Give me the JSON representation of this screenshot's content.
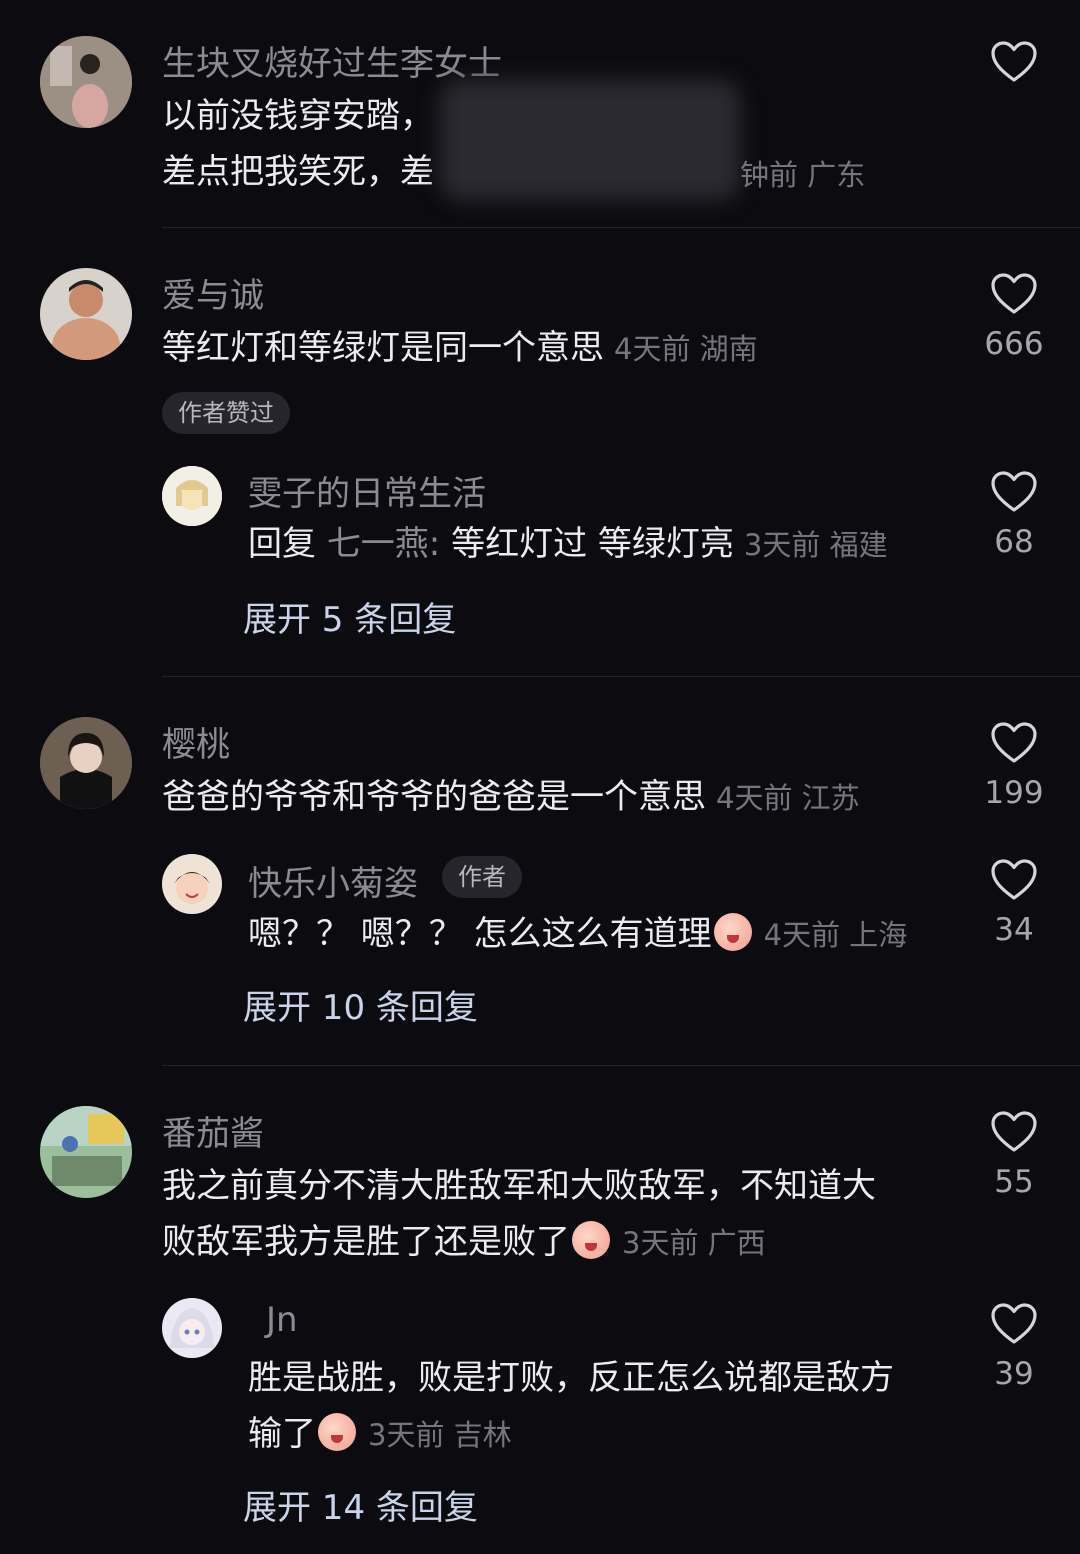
{
  "colors": {
    "background": "#0c0c10",
    "username": "#8b8b93",
    "expand": "#c9d3ea"
  },
  "comments": [
    {
      "username": "生块叉烧好过生李女士",
      "text_line1": "以前没钱穿安踏，",
      "text_line2": "差点把我笑死，差",
      "meta": "钟前 广东",
      "likes": ""
    },
    {
      "username": "爱与诚",
      "text": "等红灯和等绿灯是同一个意思",
      "meta": "4天前 湖南",
      "likes": "666",
      "tag": "作者赞过",
      "reply": {
        "username": "雯子的日常生活",
        "prefix": "回复",
        "reply_to": "七一燕:",
        "text": "等红灯过  等绿灯亮",
        "meta": "3天前 福建",
        "likes": "68"
      },
      "expand": "展开 5 条回复"
    },
    {
      "username": "樱桃",
      "text": "爸爸的爷爷和爷爷的爸爸是一个意思",
      "meta": "4天前 江苏",
      "likes": "199",
      "reply": {
        "username": "快乐小菊姿",
        "badge": "作者",
        "text": "嗯？？ 嗯？？ 怎么这么有道理",
        "meta": "4天前 上海",
        "likes": "34"
      },
      "expand": "展开 10 条回复"
    },
    {
      "username": "番茄酱",
      "text_line1": "我之前真分不清大胜敌军和大败敌军，不知道大",
      "text_line2": "败敌军我方是胜了还是败了",
      "meta": "3天前 广西",
      "likes": "55",
      "reply": {
        "username": "Jn",
        "text_line1": "胜是战胜，败是打败，反正怎么说都是敌方",
        "text_line2": "输了",
        "meta": "3天前 吉林",
        "likes": "39"
      },
      "expand": "展开 14 条回复"
    }
  ]
}
